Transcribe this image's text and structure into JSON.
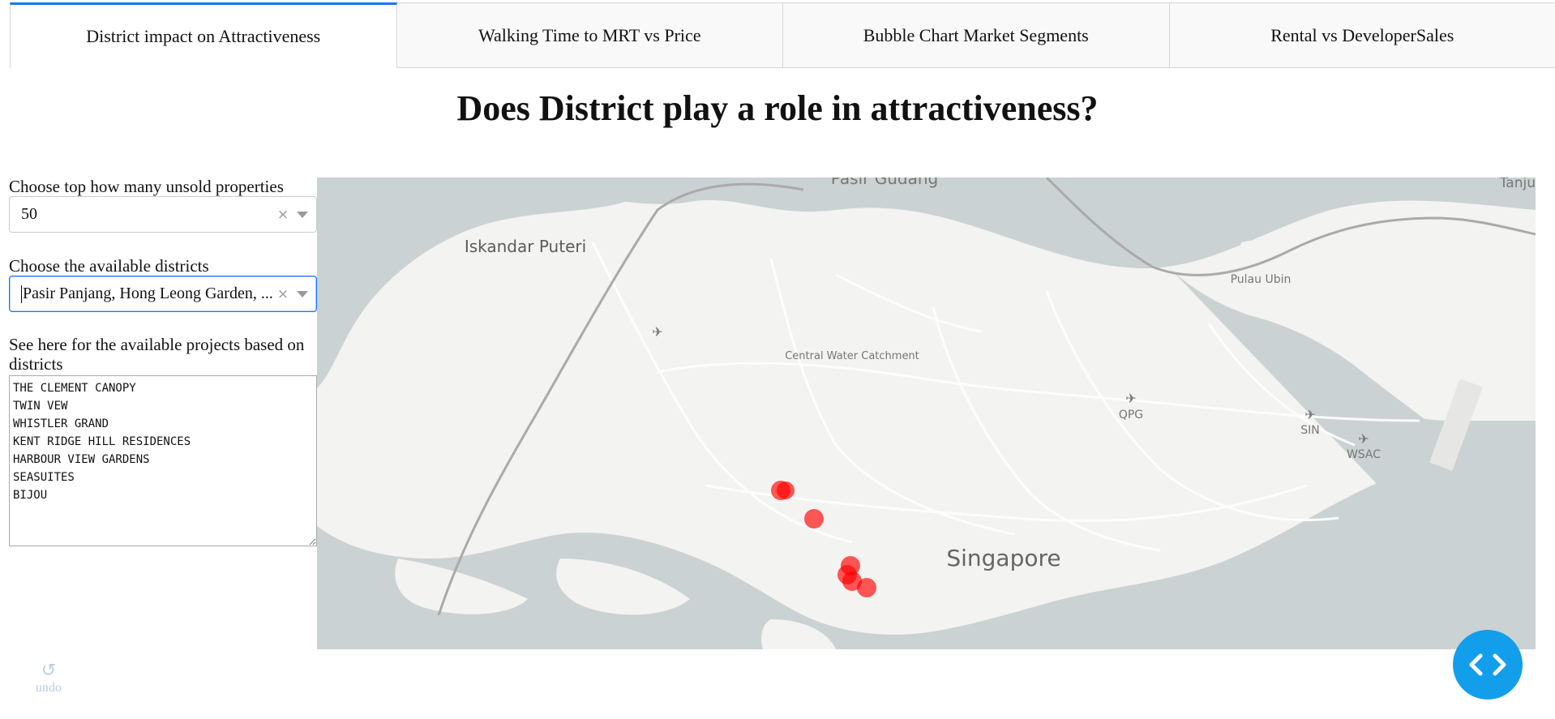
{
  "tabs": [
    {
      "label": "District impact on Attractiveness",
      "active": true
    },
    {
      "label": "Walking Time to MRT vs Price",
      "active": false
    },
    {
      "label": "Bubble Chart Market Segments",
      "active": false
    },
    {
      "label": "Rental vs DeveloperSales",
      "active": false
    }
  ],
  "page": {
    "title": "Does District play a role in attractiveness?"
  },
  "controls": {
    "top_label": "Choose top how many unsold properties",
    "top_value": "50",
    "district_label": "Choose the available districts",
    "district_value": "Pasir Panjang, Hong Leong Garden, ...",
    "projects_label": "See here for the available projects based on districts",
    "projects_text": "THE CLEMENT CANOPY\nTWIN VEW\nWHISTLER GRAND\nKENT RIDGE HILL RESIDENCES\nHARBOUR VIEW GARDENS\nSEASUITES\nBIJOU"
  },
  "map": {
    "place_labels": [
      "Pasir Gudang",
      "Tanju",
      "Iskandar Puteri",
      "Pulau Ubin",
      "Central Water Catchment",
      "QPG",
      "SIN",
      "WSAC",
      "Singapore"
    ],
    "marker_color": "#ff0000",
    "icons": [
      "airport-icon"
    ]
  },
  "undo": {
    "label": "undo",
    "icon": "undo-icon"
  },
  "devtools": {
    "icon": "code-brackets-icon",
    "color": "#129eeb"
  },
  "colors": {
    "tab_accent": "#1975fa",
    "water": "#cbd2d3",
    "land": "#f3f3f1"
  }
}
